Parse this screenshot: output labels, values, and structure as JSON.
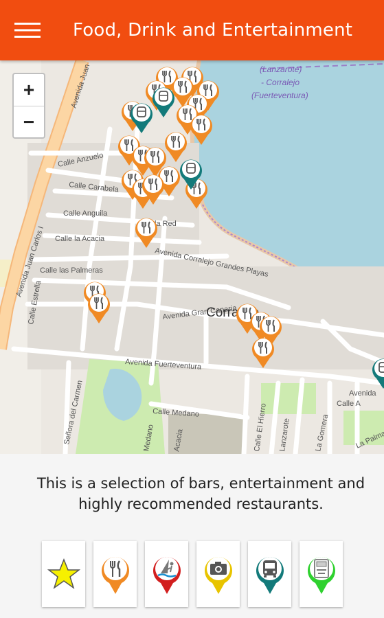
{
  "app": {
    "title": "Food, Drink and Entertainment",
    "menu_icon": "hamburger-menu-icon",
    "accent": "#f14d10"
  },
  "map": {
    "zoom_in": "+",
    "zoom_out": "−",
    "labels": {
      "avenida_juan_top": "Avenida Juan",
      "avenida_juan_carlos": "Avenida Juan Carlos I",
      "calle_anzuelo": "Calle Anzuelo",
      "calle_carabela": "Calle Carabela",
      "calle_anguila": "Calle Anguila",
      "calle_red": "la Red",
      "calle_acacia": "Calle la Acacia",
      "calle_palmeras": "Calle las Palmeras",
      "calle_estrella": "Calle Estrella",
      "avenida_corralejo": "Avenida Corralejo Grandes Playas",
      "avenida_gran_canaria": "Avenida Gran Canaria",
      "avenida_fuerteventura": "Avenida Fuerteventura",
      "corralejo": "Corralejo",
      "calle_medano": "Calle Medano",
      "senora_carmen": "Señora del Carmen",
      "medano_v": "Medano",
      "calle_hierro": "Calle El Hierro",
      "lanzarote": "Lanzarote",
      "gomera": "La Gomera",
      "calle_a": "Calle A",
      "avenida_r": "Avenida",
      "la_palma": "La Palma",
      "sea_1": "(Lanzarote)",
      "sea_2": "- Corralejo",
      "sea_3": "(Fuerteventura)",
      "acacia_v": "Acacia"
    }
  },
  "info": {
    "description": "This is a selection of bars, entertainment and highly recommended restaurants."
  },
  "categories": [
    {
      "name": "favorites",
      "icon": "star-icon",
      "color": "#f6f000"
    },
    {
      "name": "food-drink",
      "icon": "fork-knife-icon",
      "color": "#f08a24"
    },
    {
      "name": "water-sports",
      "icon": "windsurf-icon",
      "color": "#d21f1f"
    },
    {
      "name": "sightseeing",
      "icon": "camera-icon",
      "color": "#e8c400"
    },
    {
      "name": "transport",
      "icon": "bus-icon",
      "color": "#137a7a"
    },
    {
      "name": "atm",
      "icon": "atm-icon",
      "color": "#2fd12f"
    }
  ]
}
